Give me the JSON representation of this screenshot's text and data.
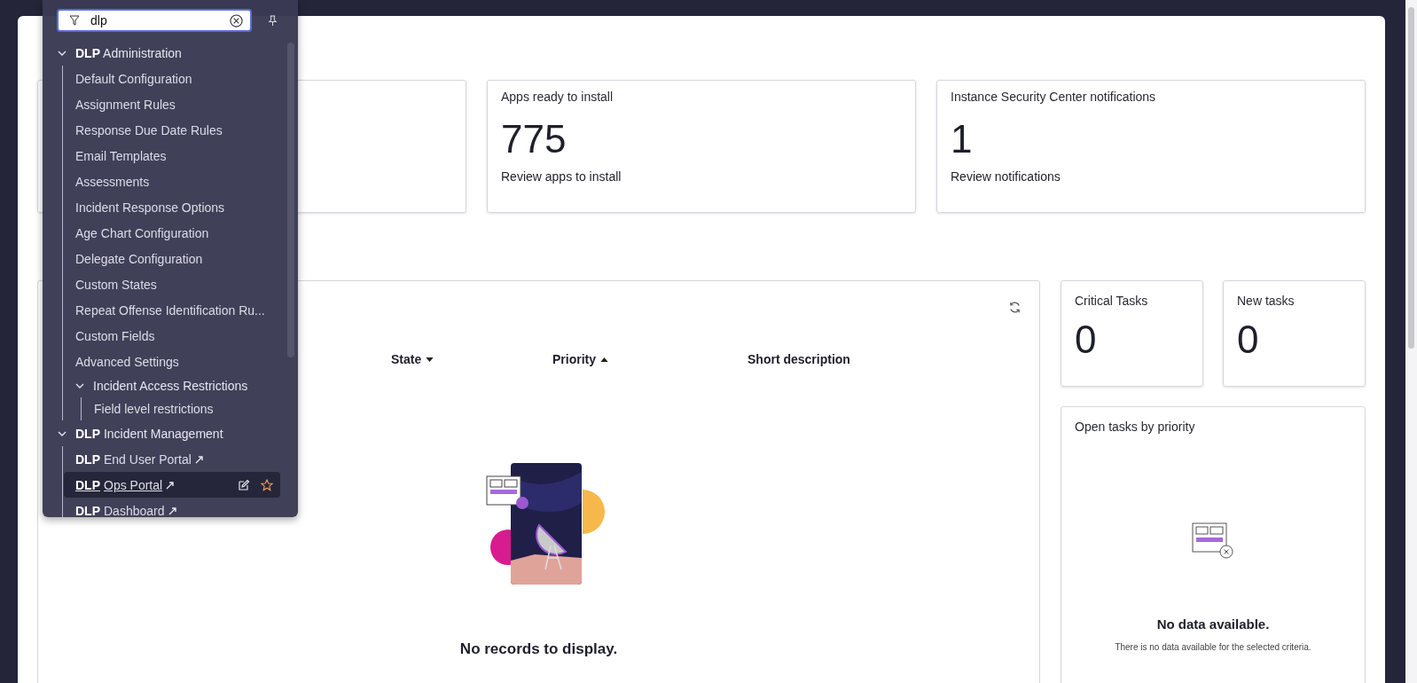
{
  "menu": {
    "filter": {
      "value": "dlp"
    },
    "tree": [
      {
        "label": "**DLP** Administration",
        "expanded": true,
        "children": [
          {
            "label": "Default Configuration",
            "selected": false
          },
          {
            "label": "Assignment Rules",
            "selected": false
          },
          {
            "label": "Response Due Date Rules",
            "selected": false
          },
          {
            "label": "Email Templates",
            "selected": false
          },
          {
            "label": "Assessments",
            "selected": false
          },
          {
            "label": "Incident Response Options",
            "selected": false
          },
          {
            "label": "Age Chart Configuration",
            "selected": false
          },
          {
            "label": "Delegate Configuration",
            "selected": false
          },
          {
            "label": "Custom States",
            "selected": false
          },
          {
            "label": "Repeat Offense Identification Ru...",
            "selected": false
          },
          {
            "label": "Custom Fields",
            "selected": false
          },
          {
            "label": "Advanced Settings",
            "selected": false
          },
          {
            "label": "Incident Access Restrictions",
            "expanded": true,
            "children": [
              {
                "label": "Field level restrictions",
                "selected": false
              }
            ]
          }
        ]
      },
      {
        "label": "**DLP** Incident Management",
        "expanded": true,
        "children": [
          {
            "label": "**DLP** End User Portal",
            "external": true,
            "selected": false
          },
          {
            "label": "**DLP** Ops Portal",
            "external": true,
            "selected": true
          },
          {
            "label": "**DLP** Dashboard",
            "external": true,
            "selected": false
          }
        ]
      }
    ]
  },
  "cards": [
    {
      "title": "Apps ready to install",
      "value": "775",
      "link": "Review apps to install"
    },
    {
      "title": "Instance Security Center notifications",
      "value": "1",
      "link": "Review notifications"
    }
  ],
  "list": {
    "columns": [
      {
        "label": "State",
        "sorted": true,
        "ascending": false
      },
      {
        "label": "Priority",
        "sorted": true,
        "ascending": true
      },
      {
        "label": "Short description",
        "sorted": false
      }
    ],
    "empty_text": "No records to display."
  },
  "stats": [
    {
      "title": "Critical Tasks",
      "value": "0"
    },
    {
      "title": "New tasks",
      "value": "0"
    }
  ],
  "chart_panel": {
    "title": "Open tasks by priority",
    "empty_title": "No data available.",
    "empty_text": "There is no data available for the selected criteria."
  }
}
